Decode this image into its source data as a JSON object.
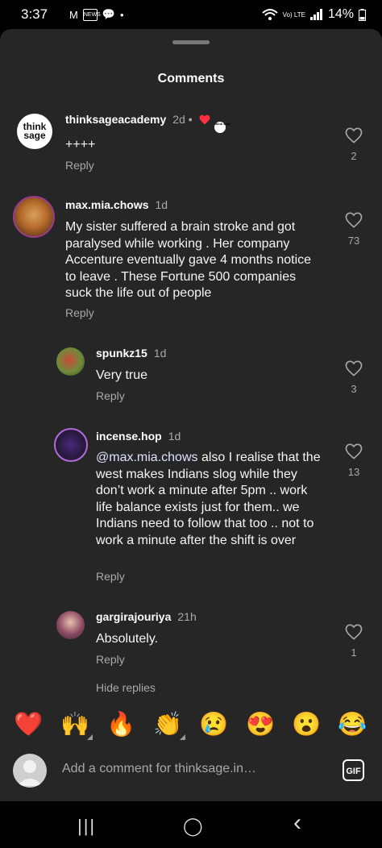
{
  "status_bar": {
    "time": "3:37",
    "icons": [
      "gmail-icon",
      "news-icon",
      "chat-icon",
      "dot"
    ],
    "signal": "Vo) LTE",
    "battery": "14%"
  },
  "sheet": {
    "title": "Comments"
  },
  "comments": [
    {
      "username": "thinksageacademy",
      "time": "2d",
      "avatar_text": "think sage",
      "text": "++++",
      "reply_label": "Reply",
      "likes": "2",
      "creator_badge": "think sage"
    },
    {
      "username": "max.mia.chows",
      "time": "1d",
      "text": "My sister suffered a brain stroke and got paralysed while working . Her company Accenture eventually gave 4 months notice to leave . These Fortune 500 companies suck the life out of people",
      "reply_label": "Reply",
      "likes": "73"
    },
    {
      "username": "spunkz15",
      "time": "1d",
      "text": "Very true",
      "reply_label": "Reply",
      "likes": "3"
    },
    {
      "username": "incense.hop",
      "time": "1d",
      "mention": "@max.mia.chows",
      "text": "also I realise that the west makes Indians slog while they don’t work a minute after 5pm .. work life balance exists just for them.. we Indians need to follow that too .. not to work a minute after the shift is over",
      "reply_label": "Reply",
      "likes": "13"
    },
    {
      "username": "gargirajouriya",
      "time": "21h",
      "text": "Absolutely.",
      "reply_label": "Reply",
      "likes": "1"
    }
  ],
  "hide_replies": "Hide replies",
  "emoji_bar": [
    "❤️",
    "🙌",
    "🔥",
    "👏",
    "😢",
    "😍",
    "😮",
    "😂"
  ],
  "composer": {
    "placeholder": "Add a comment for thinksage.in…",
    "gif_label": "GIF"
  },
  "nav_bar": {
    "recents": "|||",
    "home": "◯",
    "back": "‹"
  },
  "colors": {
    "sheet_bg": "#262626",
    "muted": "#a8a8a8",
    "heart_red": "#ff3040"
  }
}
